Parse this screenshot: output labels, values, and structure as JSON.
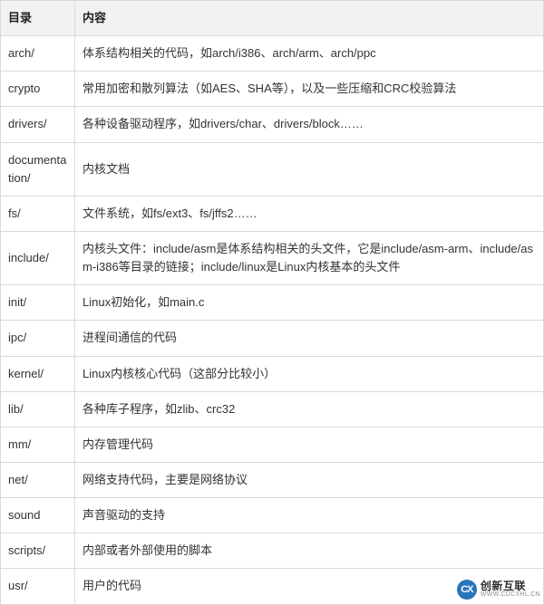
{
  "table": {
    "headers": {
      "col1": "目录",
      "col2": "内容"
    },
    "rows": [
      {
        "dir": "arch/",
        "desc": "体系结构相关的代码，如arch/i386、arch/arm、arch/ppc"
      },
      {
        "dir": "crypto",
        "desc": "常用加密和散列算法（如AES、SHA等），以及一些压缩和CRC校验算法"
      },
      {
        "dir": "drivers/",
        "desc": "各种设备驱动程序，如drivers/char、drivers/block……"
      },
      {
        "dir": "documentation/",
        "desc": "内核文档"
      },
      {
        "dir": "fs/",
        "desc": "文件系统，如fs/ext3、fs/jffs2……"
      },
      {
        "dir": "include/",
        "desc": "内核头文件：include/asm是体系结构相关的头文件，它是include/asm-arm、include/asm-i386等目录的链接；include/linux是Linux内核基本的头文件"
      },
      {
        "dir": "init/",
        "desc": "Linux初始化，如main.c"
      },
      {
        "dir": "ipc/",
        "desc": "进程间通信的代码"
      },
      {
        "dir": "kernel/",
        "desc": "Linux内核核心代码（这部分比较小）"
      },
      {
        "dir": "lib/",
        "desc": "各种库子程序，如zlib、crc32"
      },
      {
        "dir": "mm/",
        "desc": "内存管理代码"
      },
      {
        "dir": "net/",
        "desc": "网络支持代码，主要是网络协议"
      },
      {
        "dir": "sound",
        "desc": "声音驱动的支持"
      },
      {
        "dir": "scripts/",
        "desc": "内部或者外部使用的脚本"
      },
      {
        "dir": "usr/",
        "desc": "用户的代码"
      }
    ]
  },
  "watermark": {
    "logo_text": "CX",
    "main": "创新互联",
    "sub": "WWW.CDCXHL.CN"
  }
}
